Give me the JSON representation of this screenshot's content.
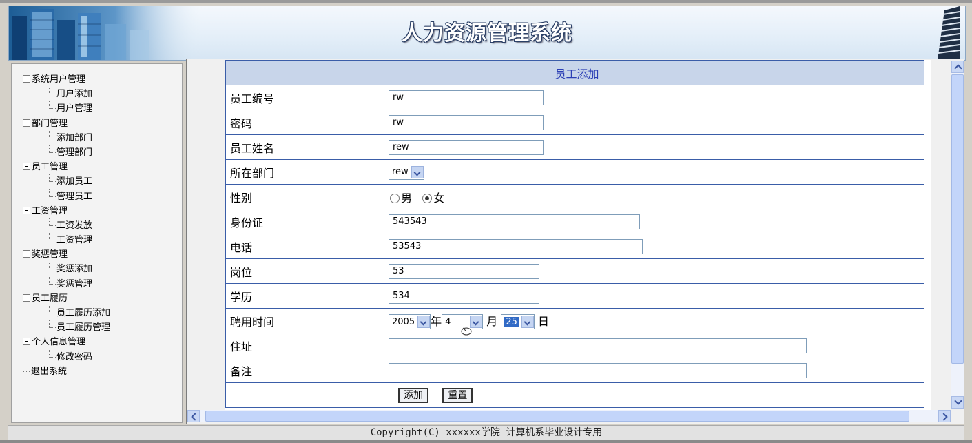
{
  "header": {
    "title": "人力资源管理系统"
  },
  "sidebar": {
    "groups": [
      {
        "label": "系统用户管理",
        "items": [
          "用户添加",
          "用户管理"
        ]
      },
      {
        "label": "部门管理",
        "items": [
          "添加部门",
          "管理部门"
        ]
      },
      {
        "label": "员工管理",
        "items": [
          "添加员工",
          "管理员工"
        ]
      },
      {
        "label": "工资管理",
        "items": [
          "工资发放",
          "工资管理"
        ]
      },
      {
        "label": "奖惩管理",
        "items": [
          "奖惩添加",
          "奖惩管理"
        ]
      },
      {
        "label": "员工履历",
        "items": [
          "员工履历添加",
          "员工履历管理"
        ]
      },
      {
        "label": "个人信息管理",
        "items": [
          "修改密码"
        ]
      }
    ],
    "exit": "退出系统"
  },
  "form": {
    "title": "员工添加",
    "employee_id": {
      "label": "员工编号",
      "value": "rw"
    },
    "password": {
      "label": "密码",
      "value": "rw"
    },
    "name": {
      "label": "员工姓名",
      "value": "rew"
    },
    "department": {
      "label": "所在部门",
      "value": "rew"
    },
    "gender": {
      "label": "性别",
      "male": "男",
      "female": "女",
      "selected": "女"
    },
    "id_card": {
      "label": "身份证",
      "value": "543543"
    },
    "phone": {
      "label": "电话",
      "value": "53543"
    },
    "position": {
      "label": "岗位",
      "value": "53"
    },
    "education": {
      "label": "学历",
      "value": "534"
    },
    "hire_date": {
      "label": "聘用时间",
      "year": "2005",
      "year_unit": "年",
      "month": "4",
      "month_unit": "月",
      "day": "25",
      "day_unit": "日"
    },
    "address": {
      "label": "住址",
      "value": ""
    },
    "remarks": {
      "label": "备注",
      "value": ""
    },
    "add_button": "添加",
    "reset_button": "重置"
  },
  "footer": {
    "text": "Copyright(C) xxxxxx学院 计算机系毕业设计专用"
  }
}
